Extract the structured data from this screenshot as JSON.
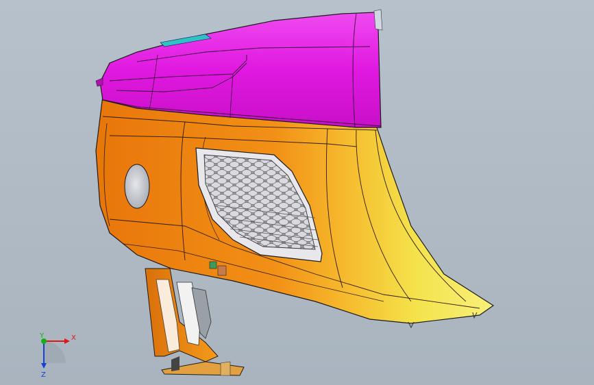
{
  "viewport": {
    "background_top": "#b7c1cb",
    "background_bottom": "#a9b4bf"
  },
  "model": {
    "top_cover_color": "#e514e5",
    "body_color": "#f08a12",
    "side_highlight_color": "#f4e64a",
    "grille_color": "#c8c8cc",
    "edge_color": "#1a1a1a"
  },
  "axis_triad": {
    "x_label": "X",
    "y_label": "Y",
    "z_label": "Z",
    "x_color": "#e01515",
    "y_color": "#15b015",
    "z_color": "#1540d0"
  }
}
